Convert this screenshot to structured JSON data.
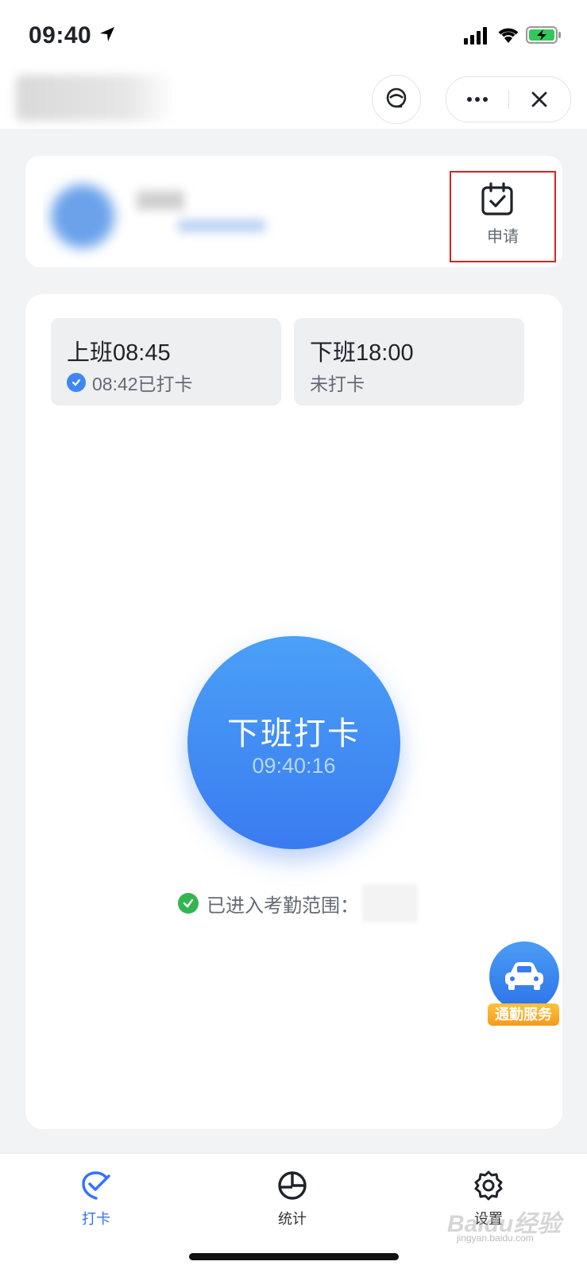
{
  "status_bar": {
    "time": "09:40"
  },
  "header": {
    "support_icon": "headset-icon",
    "more_icon": "more-icon",
    "close_icon": "close-icon"
  },
  "profile": {
    "apply_label": "申请",
    "apply_icon": "calendar-check-icon"
  },
  "shifts": [
    {
      "title": "上班08:45",
      "status": "08:42已打卡",
      "checked": true
    },
    {
      "title": "下班18:00",
      "status": "未打卡",
      "checked": false
    }
  ],
  "punch": {
    "title": "下班打卡",
    "time": "09:40:16"
  },
  "range": {
    "text": "已进入考勤范围："
  },
  "commute": {
    "label": "通勤服务",
    "icon": "car-icon"
  },
  "tabs": [
    {
      "label": "打卡",
      "icon": "check-icon",
      "active": true
    },
    {
      "label": "统计",
      "icon": "pie-chart-icon",
      "active": false
    },
    {
      "label": "设置",
      "icon": "gear-icon",
      "active": false
    }
  ],
  "watermark": {
    "text": "Baidu经验",
    "url": "jingyan.baidu.com"
  },
  "colors": {
    "accent": "#3370ff",
    "punch_blue": "#3a7bf0",
    "highlight_red": "#e02020",
    "success_green": "#34b550"
  }
}
